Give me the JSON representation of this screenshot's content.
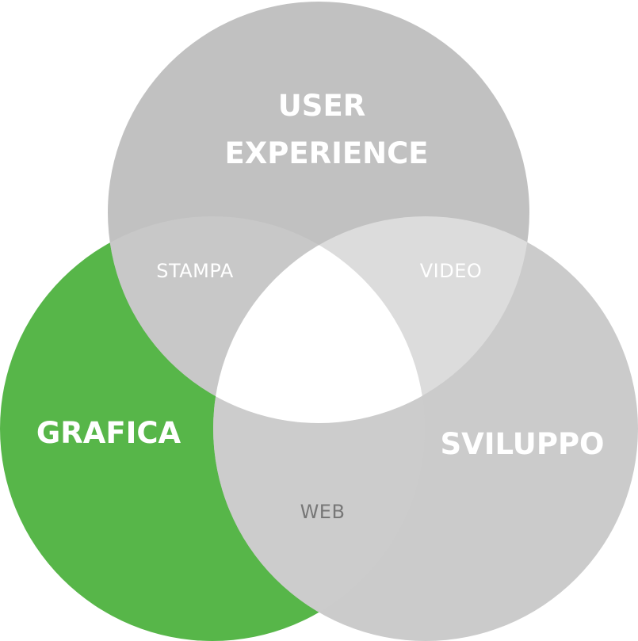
{
  "sets": [
    {
      "id": "grafica",
      "label": "GRAFICA",
      "color": "#57b649"
    },
    {
      "id": "ux",
      "label_lines": [
        "USER",
        "EXPERIENCE"
      ],
      "color": "#c1c1c1"
    },
    {
      "id": "sviluppo",
      "label": "SVILUPPO",
      "color": "#cbcbcb"
    }
  ],
  "overlaps": {
    "stampa": {
      "label": "STAMPA",
      "color": "#c8c8c8",
      "text_color": "#ffffff"
    },
    "video": {
      "label": "VIDEO",
      "color": "#dcdcdc",
      "text_color": "#ffffff"
    },
    "web": {
      "label": "WEB",
      "color": "#cccccc",
      "text_color": "#777777"
    },
    "center": {
      "color": "#ffffff"
    }
  }
}
